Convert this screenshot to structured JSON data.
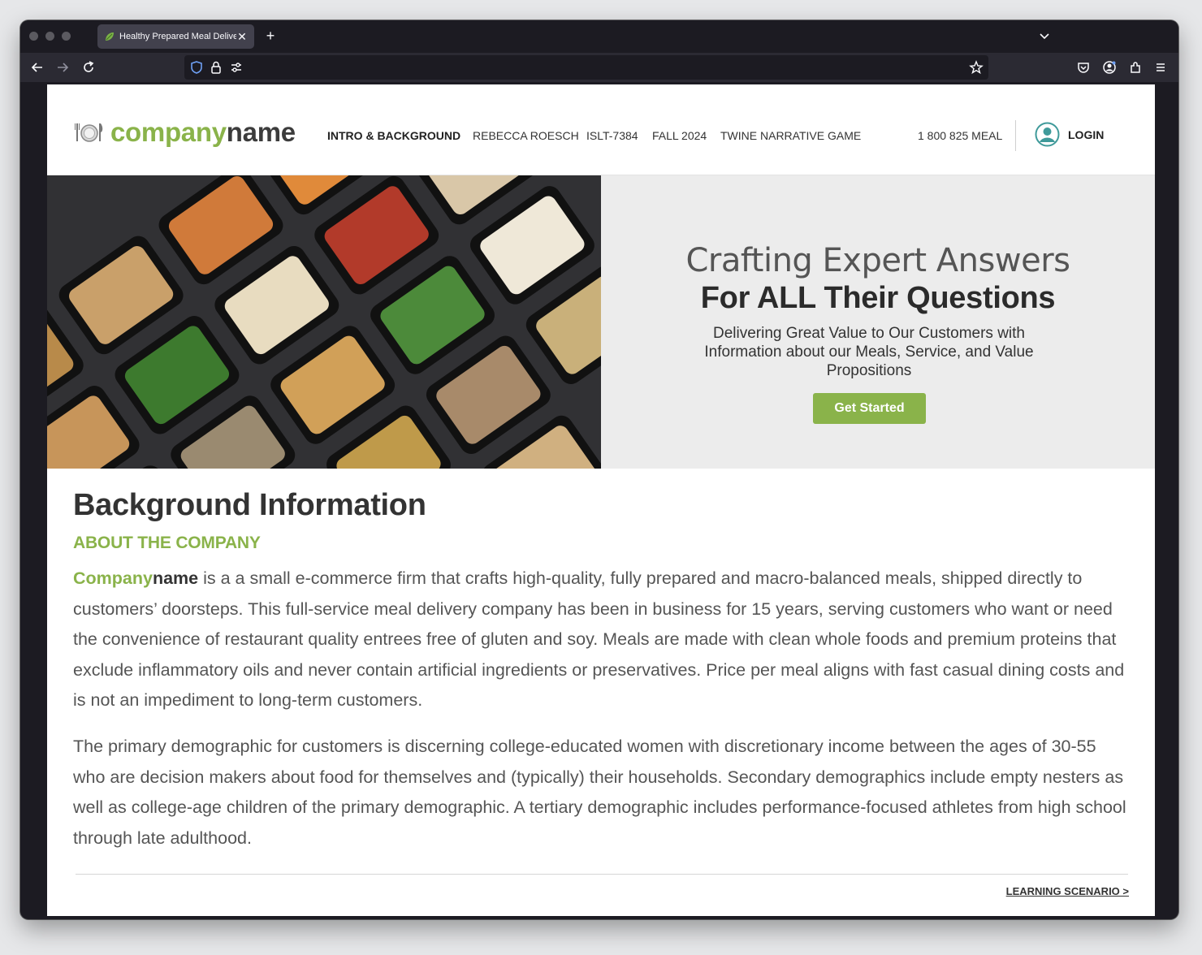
{
  "browser": {
    "tab_title": "Healthy Prepared Meal Delivery",
    "new_tab_symbol": "+",
    "close_symbol": "✕"
  },
  "site": {
    "logo_part1": "company",
    "logo_part2": "name",
    "nav": [
      {
        "label": "INTRO & BACKGROUND",
        "active": true
      },
      {
        "label": "REBECCA ROESCH",
        "active": false
      },
      {
        "label": "ISLT-7384",
        "active": false
      },
      {
        "label": "FALL 2024",
        "active": false
      },
      {
        "label": "TWINE NARRATIVE GAME",
        "active": false
      }
    ],
    "phone": "1 800 825 MEAL",
    "login": "LOGIN"
  },
  "hero": {
    "headline_light": "Crafting Expert Answers",
    "headline_bold": "For ALL Their Questions",
    "subtext": "Delivering Great Value to Our Customers with Information about our Meals, Service, and Value Propositions",
    "cta": "Get Started"
  },
  "content": {
    "title": "Background Information",
    "subtitle": "ABOUT THE COMPANY",
    "brand_part1": "Company",
    "brand_part2": "name",
    "para1_rest": " is a a small e-commerce firm that crafts high-quality, fully prepared and macro-balanced meals, shipped directly to customers’ doorsteps. This full-service meal delivery company has been in business for 15 years, serving customers who want or need the convenience of restaurant quality entrees free of gluten and soy. Meals are made with clean whole foods and premium proteins that exclude inflammatory oils and never contain artificial ingredients or preservatives. Price per meal aligns with fast casual dining costs and is not an impediment to long-term customers.",
    "para2": "The primary demographic for customers is discerning college-educated women with discretionary income between the ages of 30-55 who are decision makers about food for themselves and (typically) their households. Secondary demographics include empty nesters as well as college-age children of the primary demographic. A tertiary demographic includes performance-focused athletes from high school through late adulthood.",
    "next_link": "LEARNING SCENARIO >"
  },
  "colors": {
    "brand_green": "#8ab34a",
    "browser_chrome": "#1c1b22",
    "hero_bg": "#ececec"
  }
}
